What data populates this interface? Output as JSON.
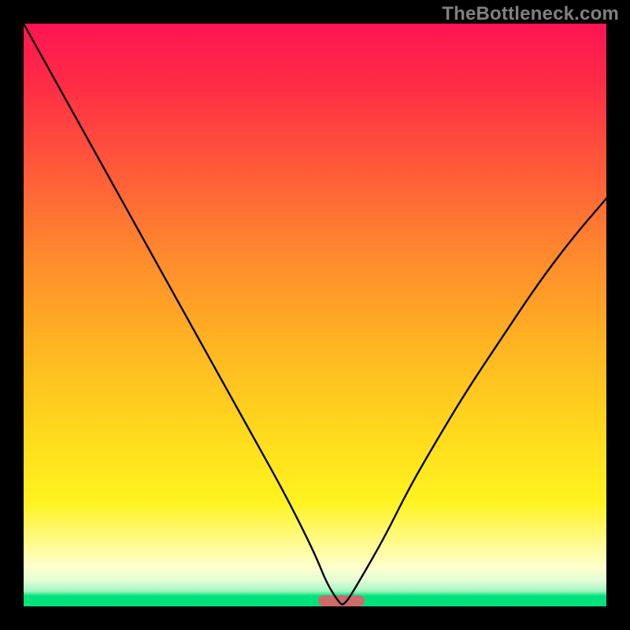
{
  "watermark": "TheBottleneck.com",
  "chart_data": {
    "type": "line",
    "title": "",
    "xlabel": "",
    "ylabel": "",
    "xlim": [
      0,
      100
    ],
    "ylim": [
      0,
      100
    ],
    "grid": false,
    "legend": false,
    "series": [
      {
        "name": "bottleneck-curve",
        "x": [
          0,
          5,
          10,
          15,
          20,
          25,
          30,
          35,
          40,
          45,
          50,
          52,
          54,
          55,
          58,
          62,
          66,
          70,
          76,
          82,
          88,
          94,
          100
        ],
        "values": [
          100,
          91,
          82,
          73,
          64,
          55,
          46,
          37,
          28,
          19,
          9,
          4,
          0.8,
          0,
          5,
          12,
          20,
          27,
          37,
          46,
          55,
          63,
          70
        ]
      }
    ],
    "optimal_marker": {
      "x_start": 50.5,
      "x_end": 58.5,
      "label": "optimal-range"
    },
    "background_gradient": {
      "top": "#ff1452",
      "mid_upper": "#ff8a2d",
      "mid_lower": "#ffd91e",
      "bottom_accent": "#00e27c"
    }
  }
}
